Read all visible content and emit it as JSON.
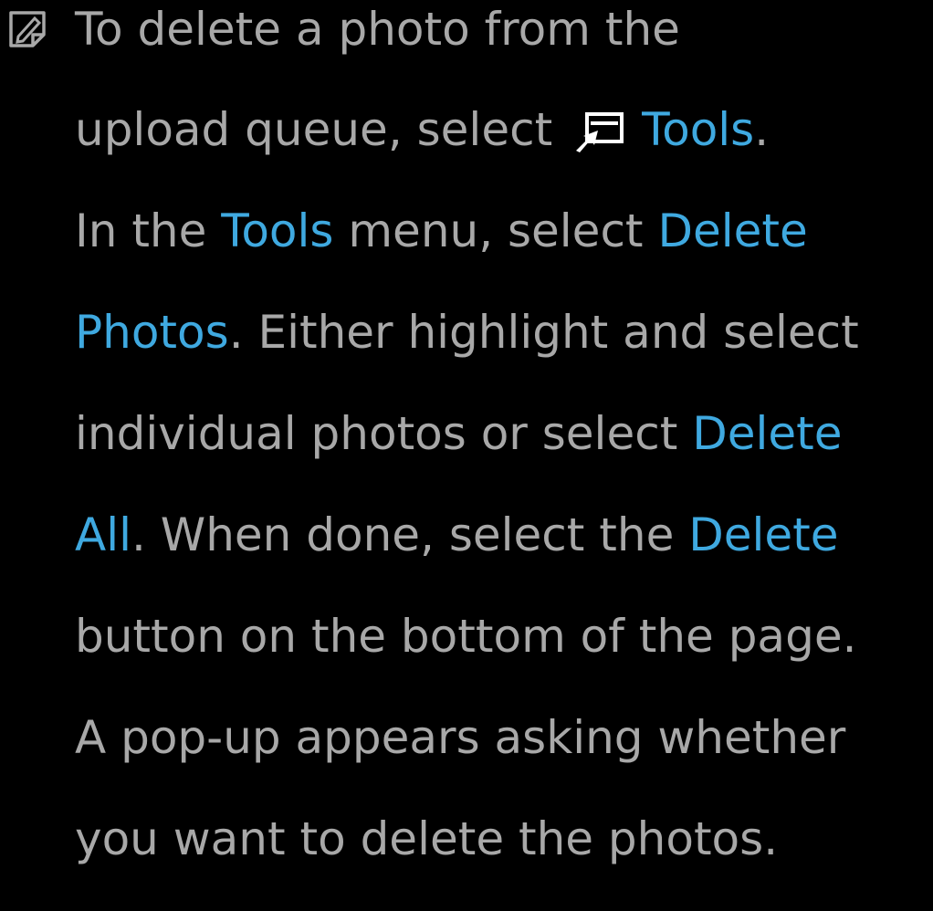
{
  "colors": {
    "background": "#000000",
    "text": "#a8a8a8",
    "highlight": "#3fa9e0"
  },
  "icons": {
    "note": "note-pencil-icon",
    "tools": "tools-remote-icon"
  },
  "lines": [
    {
      "t1": "To delete a photo from the"
    },
    {
      "t1": "upload queue, select ",
      "h1": "Tools",
      "t2": "."
    },
    {
      "t1": "In the ",
      "h1": "Tools",
      "t2": " menu, select ",
      "h2": "Delete"
    },
    {
      "h1": "Photos",
      "t1": ". Either highlight and select"
    },
    {
      "t1": "individual photos or select ",
      "h1": "Delete"
    },
    {
      "h1": "All",
      "t1": ". When done, select the ",
      "h2": "Delete"
    },
    {
      "t1": "button on the bottom of the page."
    },
    {
      "t1": "A pop-up appears asking whether"
    },
    {
      "t1": "you want to delete the photos."
    }
  ]
}
